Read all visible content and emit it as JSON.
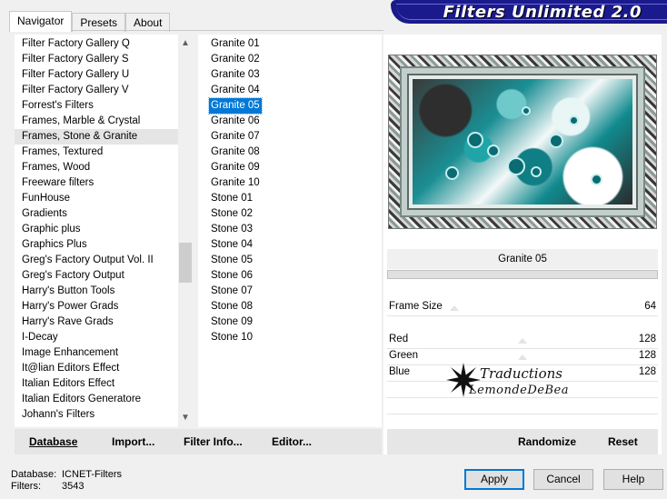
{
  "tabs": [
    "Navigator",
    "Presets",
    "About"
  ],
  "app_title": "Filters Unlimited 2.0",
  "categories": [
    "Filter Factory Gallery Q",
    "Filter Factory Gallery S",
    "Filter Factory Gallery U",
    "Filter Factory Gallery V",
    "Forrest's Filters",
    "Frames, Marble & Crystal",
    "Frames, Stone & Granite",
    "Frames, Textured",
    "Frames, Wood",
    "Freeware filters",
    "FunHouse",
    "Gradients",
    "Graphic plus",
    "Graphics Plus",
    "Greg's Factory Output Vol. II",
    "Greg's Factory Output",
    "Harry's Button Tools",
    "Harry's Power Grads",
    "Harry's Rave Grads",
    "I-Decay",
    "Image Enhancement",
    "It@lian Editors Effect",
    "Italian Editors Effect",
    "Italian Editors Generatore",
    "Johann's Filters"
  ],
  "selected_category_index": 6,
  "filters": [
    "Granite 01",
    "Granite 02",
    "Granite 03",
    "Granite 04",
    "Granite 05",
    "Granite 06",
    "Granite 07",
    "Granite 08",
    "Granite 09",
    "Granite 10",
    "Stone 01",
    "Stone 02",
    "Stone 03",
    "Stone 04",
    "Stone 05",
    "Stone 06",
    "Stone 07",
    "Stone 08",
    "Stone 09",
    "Stone 10"
  ],
  "selected_filter_index": 4,
  "bottom_buttons": {
    "database": "Database",
    "import": "Import...",
    "filter_info": "Filter Info...",
    "editor": "Editor..."
  },
  "preview": {
    "filter_name": "Granite 05",
    "params": [
      {
        "label": "Frame Size",
        "value": "64"
      },
      {
        "label": "Red",
        "value": "128"
      },
      {
        "label": "Green",
        "value": "128"
      },
      {
        "label": "Blue",
        "value": "128"
      }
    ]
  },
  "watermark": {
    "line1": "Traductions",
    "line2": "LemondeDeBea"
  },
  "right_buttons": {
    "randomize": "Randomize",
    "reset": "Reset"
  },
  "status": {
    "database_label": "Database:",
    "database_value": "ICNET-Filters",
    "filters_label": "Filters:",
    "filters_value": "3543"
  },
  "dialog_buttons": {
    "apply": "Apply",
    "cancel": "Cancel",
    "help": "Help"
  },
  "colors": {
    "selection": "#0078d7",
    "banner": "#1a1a8c"
  },
  "icons": {
    "scroll_up": "chevron-up-icon",
    "scroll_down": "chevron-down-icon"
  }
}
